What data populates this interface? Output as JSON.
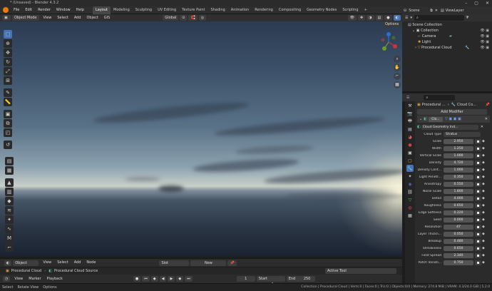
{
  "window": {
    "title": "* (Unsaved) - Blender 4.3.2"
  },
  "menu": [
    "File",
    "Edit",
    "Render",
    "Window",
    "Help"
  ],
  "workspaces": [
    "Layout",
    "Modeling",
    "Sculpting",
    "UV Editing",
    "Texture Paint",
    "Shading",
    "Animation",
    "Rendering",
    "Compositing",
    "Geometry Nodes",
    "Scripting"
  ],
  "scene": {
    "label": "Scene",
    "view_layer": "ViewLayer"
  },
  "viewport_header": {
    "mode": "Object Mode",
    "menus": [
      "View",
      "Select",
      "Add",
      "Object",
      "GIS"
    ],
    "transform": "Global",
    "options_label": "Options"
  },
  "outliner": {
    "root": "Scene Collection",
    "collection": "Collection",
    "items": [
      "Camera",
      "Light",
      "Procedural Cloud"
    ]
  },
  "properties": {
    "breadcrumb_obj": "Procedural ...",
    "breadcrumb_mod": "Cloud Co...",
    "add_modifier": "Add Modifier",
    "modifier_name": "Clo...",
    "nodegroup": "Cloud Geometry Ind...",
    "cloud_type_label": "Cloud Type",
    "cloud_type_value": "Stratus",
    "params": [
      {
        "label": "Scale",
        "value": "2.950"
      },
      {
        "label": "Width",
        "value": "1.250"
      },
      {
        "label": "Vertical Scale",
        "value": "1.000"
      },
      {
        "label": "Density",
        "value": "4.720"
      },
      {
        "label": "Density Cont...",
        "value": "1.000"
      },
      {
        "label": "Light Penetr...",
        "value": "0.350"
      },
      {
        "label": "Anisotropy",
        "value": "0.550"
      },
      {
        "label": "Noise Scale",
        "value": "1.800"
      },
      {
        "label": "Detail",
        "value": "4.000"
      },
      {
        "label": "Roughness",
        "value": "0.650"
      },
      {
        "label": "Edge Softness",
        "value": "0.220"
      },
      {
        "label": "Seed",
        "value": "0.000"
      },
      {
        "label": "Resolution",
        "value": "47"
      },
      {
        "label": "Layer Thickn...",
        "value": "0.050"
      },
      {
        "label": "Breakup",
        "value": "0.480"
      },
      {
        "label": "Streakiness",
        "value": "0.650"
      },
      {
        "label": "Field Spread",
        "value": "2.340"
      },
      {
        "label": "Patch Variati...",
        "value": "0.750"
      }
    ]
  },
  "timeline": {
    "mode": "Object",
    "menus": [
      "View",
      "Select",
      "Add",
      "Node"
    ],
    "slot": "Slot",
    "new_label": "New",
    "breadcrumb_obj": "Procedural Cloud",
    "breadcrumb_src": "Procedural Cloud Source",
    "active_tool": "Active Tool",
    "playback_menus": [
      "View",
      "Marker",
      "Playback"
    ],
    "frame_current": "1",
    "start_label": "Start",
    "start_value": "1",
    "end_label": "End",
    "end_value": "250"
  },
  "statusbar": {
    "items": [
      "Select",
      "Rotate View",
      "Options"
    ],
    "info": "Collection | Procedural Cloud | Verts:0 | Faces:0 | Tris:0 | Objects:0/4 | Memory: 274.8 MiB | VRAM: 4.3/24.0 GiB | 5.2.0"
  }
}
